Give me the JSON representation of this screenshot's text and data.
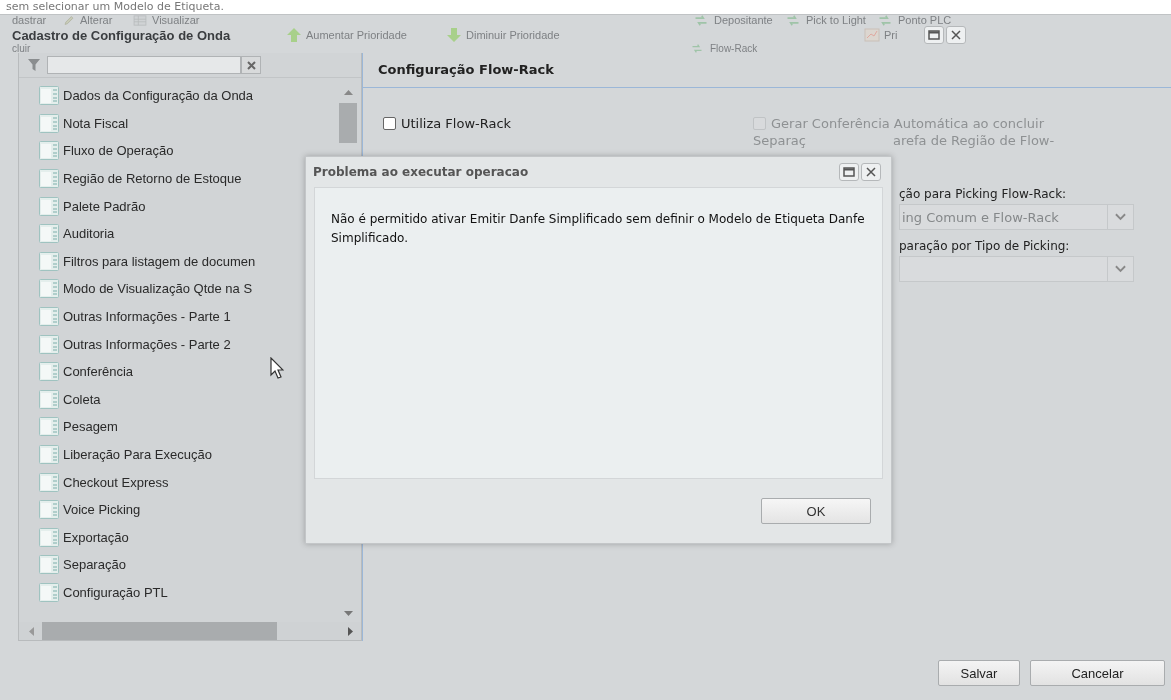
{
  "top_caption": "sem selecionar um Modelo de Etiqueta.",
  "background_toolbar": {
    "row_1": [
      {
        "label": "dastrar",
        "kind": "plain"
      },
      {
        "label": "Alterar",
        "kind": "pencil"
      },
      {
        "label": "Visualizar",
        "kind": "table"
      },
      {
        "label": "Depositante",
        "kind": "arrows"
      },
      {
        "label": "Pick to Light",
        "kind": "arrows"
      },
      {
        "label": "Ponto PLC",
        "kind": "arrows"
      }
    ],
    "row_2": [
      {
        "label": "Aumentar Prioridade",
        "kind": "up"
      },
      {
        "label": "Diminuir Prioridade",
        "kind": "down"
      },
      {
        "label": "Pri",
        "kind": "chart"
      }
    ],
    "row_3": [
      {
        "label": "cluir",
        "kind": "plain"
      },
      {
        "label": "Flow-Rack",
        "kind": "arrows"
      }
    ]
  },
  "window": {
    "title": "Cadastro de Configuração de Onda"
  },
  "tree": {
    "items": [
      {
        "label": "Dados da Configuração da Onda"
      },
      {
        "label": "Nota Fiscal"
      },
      {
        "label": "Fluxo de Operação"
      },
      {
        "label": "Região de Retorno de Estoque"
      },
      {
        "label": "Palete Padrão"
      },
      {
        "label": "Auditoria"
      },
      {
        "label": "Filtros para listagem de documen"
      },
      {
        "label": "Modo de Visualização Qtde na S"
      },
      {
        "label": "Outras Informações - Parte 1"
      },
      {
        "label": "Outras Informações - Parte 2"
      },
      {
        "label": "Conferência"
      },
      {
        "label": "Coleta"
      },
      {
        "label": "Pesagem"
      },
      {
        "label": "Liberação Para Execução"
      },
      {
        "label": "Checkout Express"
      },
      {
        "label": "Voice Picking"
      },
      {
        "label": "Exportação"
      },
      {
        "label": "Separação"
      },
      {
        "label": "Configuração PTL"
      }
    ]
  },
  "panel": {
    "title": "Configuração Flow-Rack",
    "utiliza": {
      "label": "Utiliza Flow-Rack",
      "checked": false,
      "disabled": false
    },
    "gerar": {
      "label": "Gerar Conferência Automática ao concluir",
      "checked": false,
      "disabled": true
    },
    "gerar_line_2": [
      "Separaç",
      "arefa de Região de Flow-"
    ],
    "picking_label": "ção para Picking Flow-Rack:",
    "picking_value": "ing Comum e Flow-Rack",
    "tipo_label": "paração por Tipo de Picking:"
  },
  "dialog": {
    "title": "Problema ao executar operacao",
    "message": "Não é permitido ativar Emitir Danfe Simplificado sem definir o Modelo de Etiqueta Danfe Simplificado.",
    "button": "OK"
  },
  "footer": {
    "buttons": [
      "Salvar",
      "Cancelar"
    ]
  }
}
